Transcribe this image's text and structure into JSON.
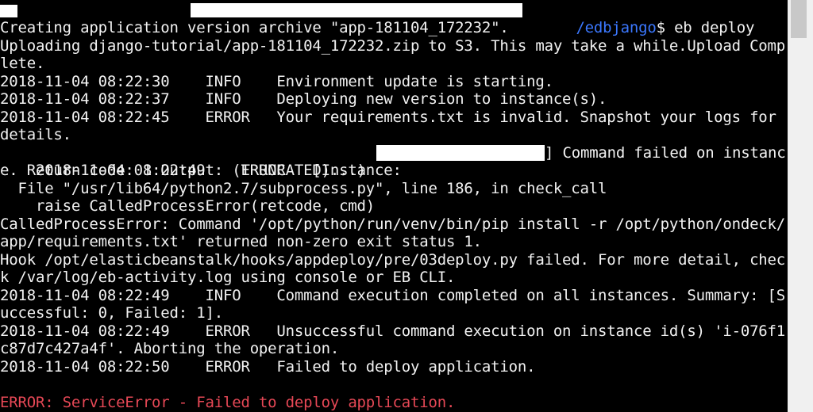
{
  "colors": {
    "background": "#000000",
    "text": "#f2f2f2",
    "prompt_path": "#3b78ff",
    "error": "#e74856"
  },
  "prompt": {
    "path": "/edbjango",
    "command": "$ eb deploy"
  },
  "output": [
    "Creating application version archive \"app-181104_172232\".",
    "Uploading django-tutorial/app-181104_172232.zip to S3. This may take a while.Upload Comp",
    "lete.",
    "2018-11-04 08:22:30    INFO    Environment update is starting.",
    "2018-11-04 08:22:37    INFO    Deploying new version to instance(s).",
    "2018-11-04 08:22:45    ERROR   Your requirements.txt is invalid. Snapshot your logs for",
    "details.",
    "2018-11-04 08:22:49    ERROR   [Instance: ",
    "e. Return code: 1 Output: (TRUNCATED)...)",
    "  File \"/usr/lib64/python2.7/subprocess.py\", line 186, in check_call",
    "    raise CalledProcessError(retcode, cmd)",
    "CalledProcessError: Command '/opt/python/run/venv/bin/pip install -r /opt/python/ondeck/",
    "app/requirements.txt' returned non-zero exit status 1.",
    "Hook /opt/elasticbeanstalk/hooks/appdeploy/pre/03deploy.py failed. For more detail, chec",
    "k /var/log/eb-activity.log using console or EB CLI.",
    "2018-11-04 08:22:49    INFO    Command execution completed on all instances. Summary: [S",
    "uccessful: 0, Failed: 1].",
    "2018-11-04 08:22:49    ERROR   Unsuccessful command execution on instance id(s) 'i-076f1",
    "c87d7c427a4f'. Aborting the operation.",
    "2018-11-04 08:22:50    ERROR   Failed to deploy application."
  ],
  "instance_line_tail": "] Command failed on instanc",
  "final_error": "ERROR: ServiceError - Failed to deploy application."
}
